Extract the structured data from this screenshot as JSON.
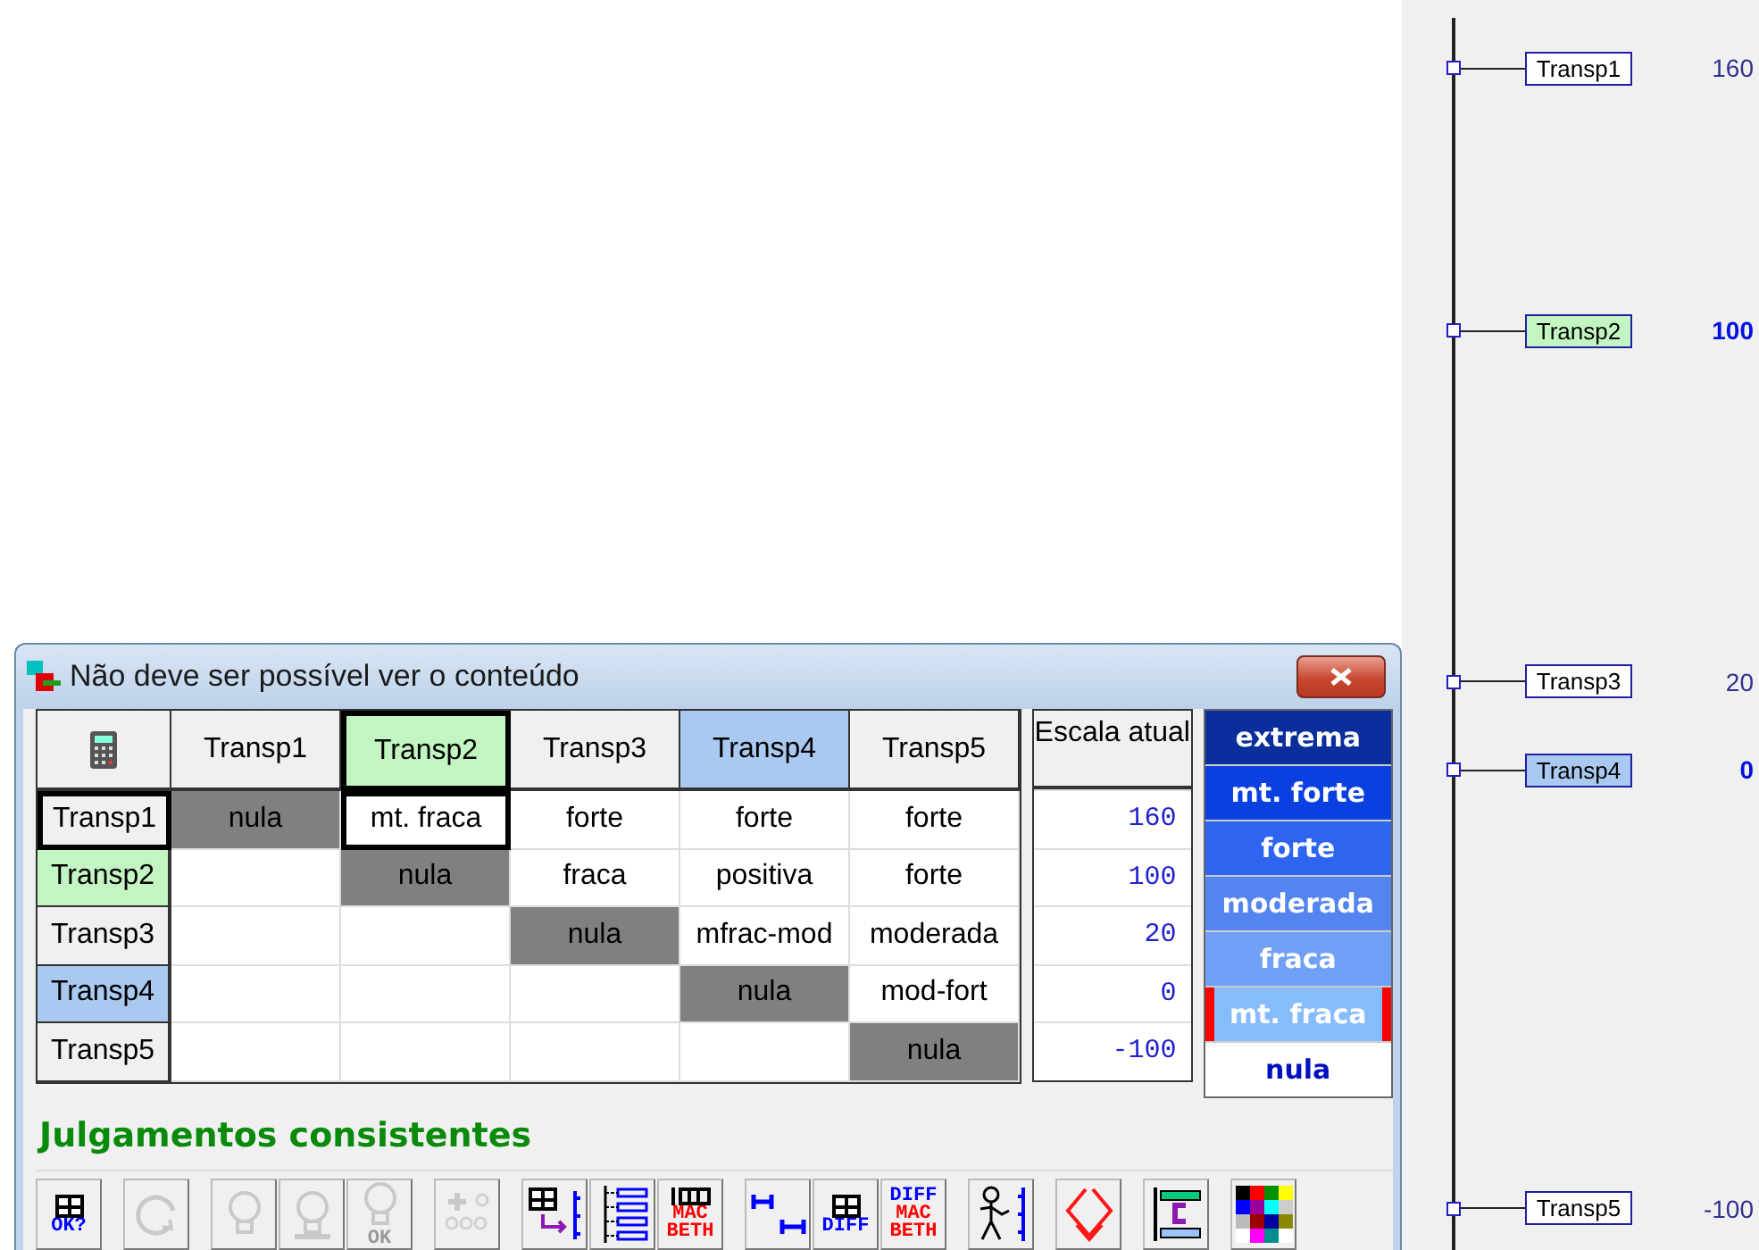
{
  "window": {
    "title": "Não deve ser possível ver o conteúdo"
  },
  "matrix": {
    "columns": [
      {
        "label": "Transp1",
        "color": "#f0f0f0",
        "selected": false
      },
      {
        "label": "Transp2",
        "color": "#c2f5c2",
        "selected": true
      },
      {
        "label": "Transp3",
        "color": "#f0f0f0",
        "selected": false
      },
      {
        "label": "Transp4",
        "color": "#a9c9f0",
        "selected": false
      },
      {
        "label": "Transp5",
        "color": "#f0f0f0",
        "selected": false
      }
    ],
    "rows": [
      {
        "label": "Transp1",
        "color": "#f0f0f0",
        "selected": true,
        "cells": [
          {
            "kind": "diagonal",
            "text": "nula",
            "selected": false
          },
          {
            "kind": "value",
            "text": "mt. fraca",
            "selected": true
          },
          {
            "kind": "value",
            "text": "forte",
            "selected": false
          },
          {
            "kind": "value",
            "text": "forte",
            "selected": false
          },
          {
            "kind": "value",
            "text": "forte",
            "selected": false
          }
        ]
      },
      {
        "label": "Transp2",
        "color": "#c2f5c2",
        "selected": false,
        "cells": [
          {
            "kind": "empty",
            "selected": false
          },
          {
            "kind": "diagonal",
            "text": "nula",
            "selected": false
          },
          {
            "kind": "value",
            "text": "fraca",
            "selected": false
          },
          {
            "kind": "value",
            "text": "positiva",
            "selected": false
          },
          {
            "kind": "value",
            "text": "forte",
            "selected": false
          }
        ]
      },
      {
        "label": "Transp3",
        "color": "#f0f0f0",
        "selected": false,
        "cells": [
          {
            "kind": "empty",
            "selected": false
          },
          {
            "kind": "empty",
            "selected": false
          },
          {
            "kind": "diagonal",
            "text": "nula",
            "selected": false
          },
          {
            "kind": "value",
            "text": "mfrac-mod",
            "selected": false
          },
          {
            "kind": "value",
            "text": "moderada",
            "selected": false
          }
        ]
      },
      {
        "label": "Transp4",
        "color": "#a9c9f0",
        "selected": false,
        "cells": [
          {
            "kind": "empty",
            "selected": false
          },
          {
            "kind": "empty",
            "selected": false
          },
          {
            "kind": "empty",
            "selected": false
          },
          {
            "kind": "diagonal",
            "text": "nula",
            "selected": false
          },
          {
            "kind": "value",
            "text": "mod-fort",
            "selected": false
          }
        ]
      },
      {
        "label": "Transp5",
        "color": "#f0f0f0",
        "selected": false,
        "cells": [
          {
            "kind": "empty",
            "selected": false
          },
          {
            "kind": "empty",
            "selected": false
          },
          {
            "kind": "empty",
            "selected": false
          },
          {
            "kind": "empty",
            "selected": false
          },
          {
            "kind": "diagonal",
            "text": "nula",
            "selected": false
          }
        ]
      }
    ]
  },
  "scale": {
    "title": "Escala atual",
    "values": [
      "160",
      "100",
      "20",
      "0",
      "-100"
    ]
  },
  "intensities": [
    {
      "label": "extrema",
      "color": "#0a2f9c",
      "selected": false
    },
    {
      "label": "mt. forte",
      "color": "#0a40e0",
      "selected": false
    },
    {
      "label": "forte",
      "color": "#2d64f0",
      "selected": false
    },
    {
      "label": "moderada",
      "color": "#5484f0",
      "selected": false
    },
    {
      "label": "fraca",
      "color": "#70a0f5",
      "selected": false
    },
    {
      "label": "mt. fraca",
      "color": "#86bcfc",
      "selected": true
    },
    {
      "label": "nula",
      "color": "#ffffff",
      "selected": false
    }
  ],
  "status": "Julgamentos consistentes",
  "toolbar": [
    [
      {
        "kind": "grid-check",
        "disabled": false,
        "lines": [
          "OK?"
        ]
      }
    ],
    [
      {
        "kind": "refresh",
        "disabled": true
      }
    ],
    [
      {
        "kind": "bulb",
        "disabled": true
      },
      {
        "kind": "bulb-stand",
        "disabled": true
      },
      {
        "kind": "bulb-ok",
        "disabled": true,
        "lines": [
          "OK"
        ]
      }
    ],
    [
      {
        "kind": "plus-people",
        "disabled": true
      }
    ],
    [
      {
        "kind": "grid-arrow",
        "disabled": false
      },
      {
        "kind": "tree",
        "disabled": false
      },
      {
        "kind": "grid-macbeth",
        "disabled": false,
        "lines": [
          "MAC",
          "BETH"
        ]
      }
    ],
    [
      {
        "kind": "h-bars",
        "disabled": false
      },
      {
        "kind": "grid-diff",
        "disabled": false,
        "lines": [
          "DIFF"
        ]
      },
      {
        "kind": "diff-macbeth",
        "disabled": false,
        "lines": [
          "DIFF",
          "MAC",
          "BETH"
        ]
      }
    ],
    [
      {
        "kind": "stick-figure",
        "disabled": false
      }
    ],
    [
      {
        "kind": "diamond",
        "disabled": false
      }
    ],
    [
      {
        "kind": "bar-c",
        "disabled": false
      }
    ],
    [
      {
        "kind": "palette",
        "disabled": false
      }
    ]
  ],
  "scale_chart": {
    "items": [
      {
        "label": "Transp1",
        "value": "160",
        "color": "#ffffff",
        "highlighted": false
      },
      {
        "label": "Transp2",
        "value": "100",
        "color": "#c2f5c2",
        "highlighted": true
      },
      {
        "label": "Transp3",
        "value": "20",
        "color": "#ffffff",
        "highlighted": false
      },
      {
        "label": "Transp4",
        "value": "0",
        "color": "#a9c9f0",
        "highlighted": true
      },
      {
        "label": "Transp5",
        "value": "-100",
        "color": "#ffffff",
        "highlighted": false
      }
    ]
  }
}
